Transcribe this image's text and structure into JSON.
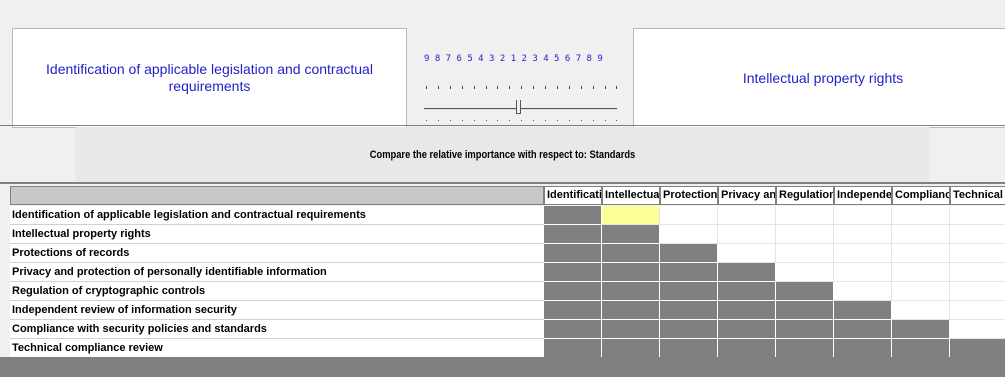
{
  "comparison": {
    "left_criterion": "Identification of applicable legislation and contractual requirements",
    "right_criterion": "Intellectual property rights",
    "scale_numbers": "9 8 7 6 5 4 3 2 1 2 3 4 5 6 7 8 9",
    "slider_value": 1
  },
  "prompt": "Compare the relative importance with respect to: Standards",
  "matrix": {
    "column_headers": [
      "Identificati",
      "Intellectual",
      "Protections",
      "Privacy an",
      "Regulation",
      "Independe",
      "Complianc",
      "Technical c"
    ],
    "rows": [
      "Identification of applicable legislation and contractual requirements",
      "Intellectual property rights",
      "Protections of records",
      "Privacy and protection of personally identifiable information",
      "Regulation of cryptographic controls",
      "Independent review of information security",
      "Compliance with security policies and standards",
      "Technical compliance review"
    ],
    "highlighted_cell": {
      "row": 0,
      "col": 1
    }
  }
}
